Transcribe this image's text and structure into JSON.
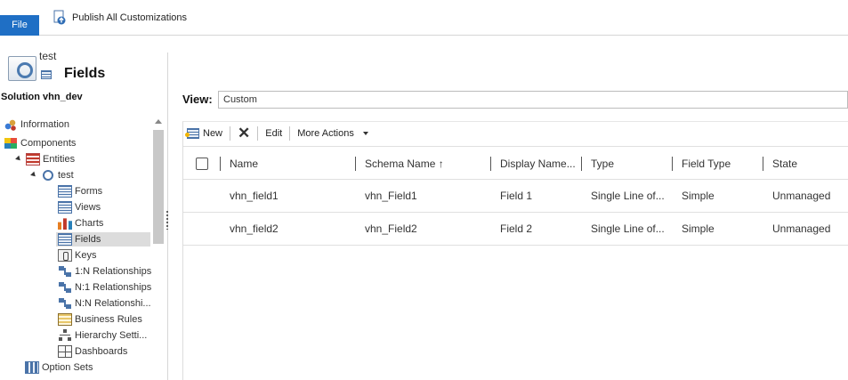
{
  "ribbon": {
    "file_label": "File",
    "publish_label": "Publish All Customizations"
  },
  "header": {
    "entity_name": "test",
    "section_title": "Fields"
  },
  "solution_label": "Solution vhn_dev",
  "nav": {
    "information": "Information",
    "components": "Components",
    "entities": "Entities",
    "entity_test": "test",
    "forms": "Forms",
    "views": "Views",
    "charts": "Charts",
    "fields": "Fields",
    "keys": "Keys",
    "rel_1n": "1:N Relationships",
    "rel_n1": "N:1 Relationships",
    "rel_nn": "N:N Relationshi...",
    "business_rules": "Business Rules",
    "hierarchy": "Hierarchy Setti...",
    "dashboards": "Dashboards",
    "option_sets": "Option Sets",
    "selected": "Fields"
  },
  "view": {
    "label": "View:",
    "value": "Custom"
  },
  "commands": {
    "new": "New",
    "edit": "Edit",
    "more_actions": "More Actions"
  },
  "table": {
    "columns": [
      "Name",
      "Schema Name ↑",
      "Display Name...",
      "Type",
      "Field Type",
      "State"
    ],
    "rows": [
      [
        "vhn_field1",
        "vhn_Field1",
        "Field 1",
        "Single Line of...",
        "Simple",
        "Unmanaged"
      ],
      [
        "vhn_field2",
        "vhn_Field2",
        "Field 2",
        "Single Line of...",
        "Simple",
        "Unmanaged"
      ]
    ]
  }
}
